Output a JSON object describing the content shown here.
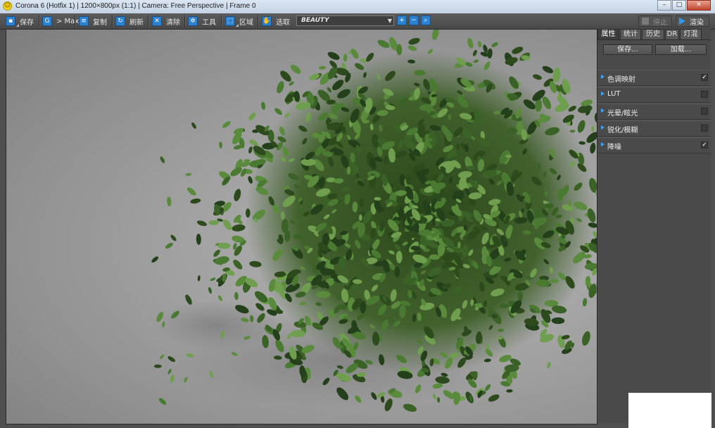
{
  "window": {
    "title": "Corona 6 (Hotfix 1) | 1200×800px (1:1) | Camera: Free Perspective | Frame 0",
    "app_icon": "smiley-icon",
    "controls": [
      "minimize-icon",
      "maximize-icon",
      "close-icon"
    ]
  },
  "toolbar": {
    "save_label": "保存",
    "max_label": "> Max",
    "copy_label": "复制",
    "refresh_label": "刷新",
    "clear_label": "清除",
    "tools_label": "工具",
    "region_label": "区域",
    "pick_label": "选取",
    "pass_value": "BEAUTY",
    "stop_label": "停止",
    "render_label": "渲染"
  },
  "panel": {
    "tabs": [
      "属性",
      "统计",
      "历史",
      "DR",
      "灯混"
    ],
    "active_tab": "属性",
    "save_button": "保存...",
    "load_button": "加载...",
    "sections": [
      {
        "label": "色调映射",
        "checked": true
      },
      {
        "label": "LUT",
        "checked": false
      },
      {
        "label": "光晕/眩光",
        "checked": false
      },
      {
        "label": "锐化/模糊",
        "checked": false
      },
      {
        "label": "降噪",
        "checked": true
      }
    ]
  },
  "colors": {
    "accent": "#2b82d1",
    "panel_bg": "#4a4a4a",
    "leaf_dark": "#2c4a1c",
    "leaf_mid": "#4a7a32",
    "leaf_light": "#6f9e4e"
  }
}
